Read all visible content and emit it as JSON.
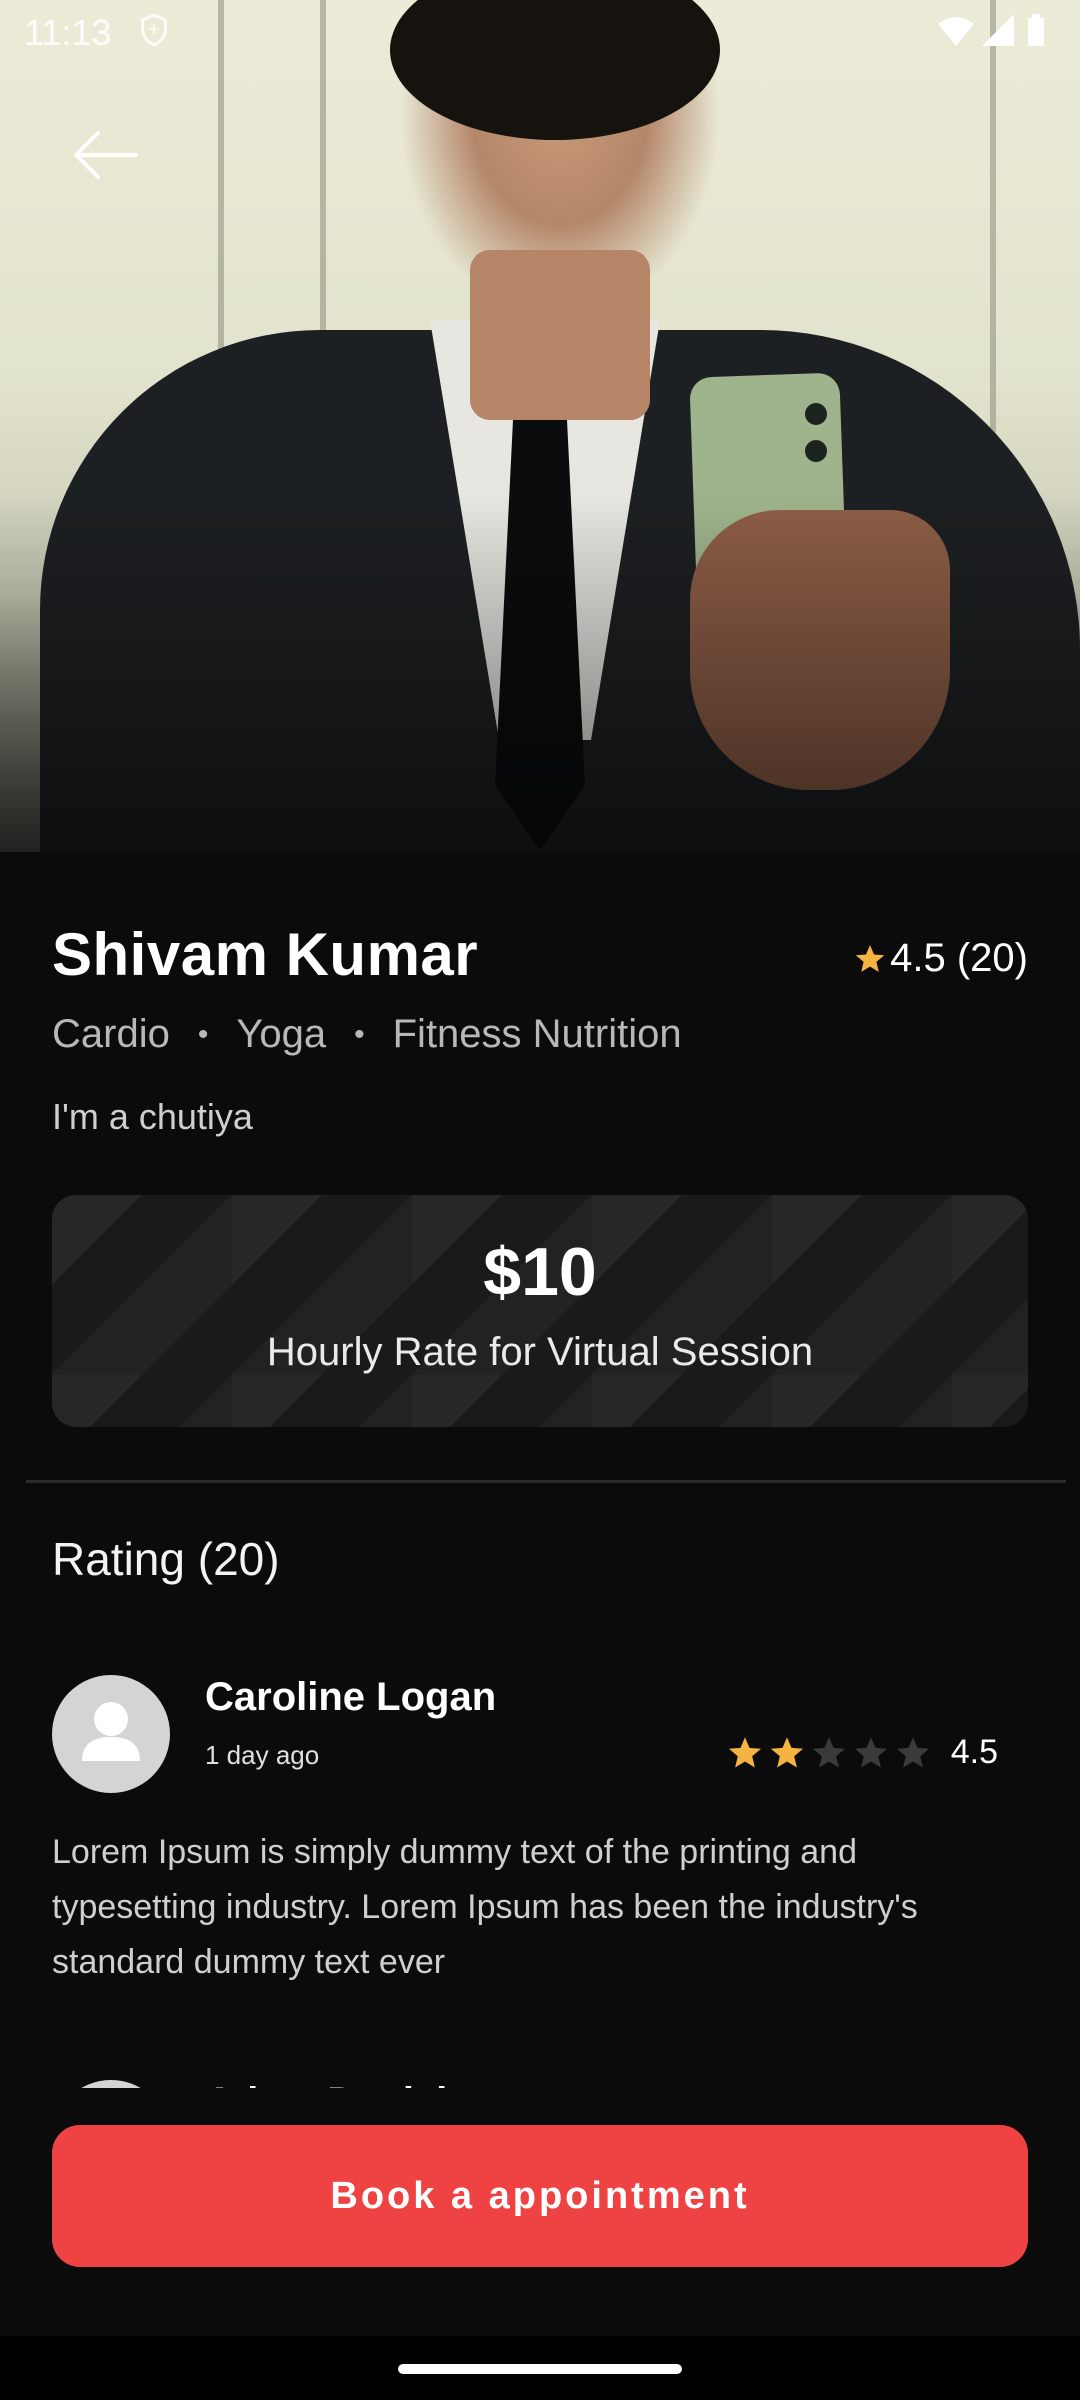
{
  "status_bar": {
    "time": "11:13"
  },
  "profile": {
    "name": "Shivam Kumar",
    "rating_summary": "4.5 (20)",
    "specialties": [
      "Cardio",
      "Yoga",
      "Fitness Nutrition"
    ],
    "bio": "I'm a chutiya"
  },
  "rate_card": {
    "price": "$10",
    "label": "Hourly Rate for Virtual Session"
  },
  "ratings": {
    "title": "Rating (20)",
    "reviews": [
      {
        "name": "Caroline Logan",
        "time": "1 day ago",
        "stars_filled": 2,
        "stars_total": 5,
        "score": "4.5",
        "text": "Lorem Ipsum is simply dummy text of the printing and typesetting industry. Lorem Ipsum has been the industry's standard dummy text ever"
      },
      {
        "name": "Adam Daniel"
      }
    ]
  },
  "actions": {
    "book_label": "Book a appointment"
  },
  "colors": {
    "accent": "#ef4343",
    "star": "#f5b342",
    "background": "#0b0b0c"
  },
  "icons": {
    "back": "arrow-left-icon",
    "star": "star-icon",
    "avatar": "person-icon",
    "shield": "shield-icon",
    "wifi": "wifi-icon",
    "signal": "signal-icon",
    "battery": "battery-icon"
  }
}
